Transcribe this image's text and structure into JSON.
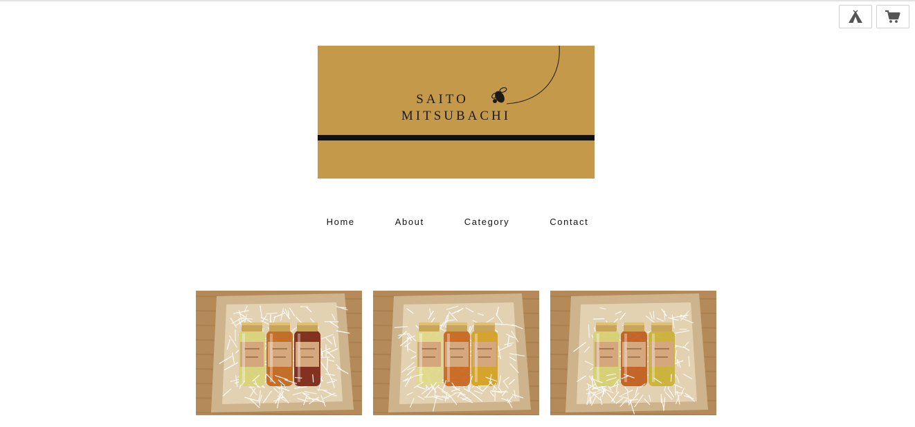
{
  "header": {
    "icons": [
      {
        "name": "tent-icon"
      },
      {
        "name": "cart-icon"
      }
    ]
  },
  "logo": {
    "line1": "SAITO",
    "line2": "MITSUBACHI",
    "colors": {
      "background": "#c49a4a",
      "stripe": "#111111",
      "text": "#1c1a16"
    }
  },
  "nav": {
    "items": [
      {
        "label": "Home"
      },
      {
        "label": "About"
      },
      {
        "label": "Category"
      },
      {
        "label": "Contact"
      }
    ]
  },
  "products": [
    {
      "name": "honey-set-1",
      "jar_colors": [
        "#d8d27a",
        "#c0661e",
        "#7a2412"
      ]
    },
    {
      "name": "honey-set-2",
      "jar_colors": [
        "#e0d98a",
        "#c8641c",
        "#d2a021"
      ]
    },
    {
      "name": "honey-set-3",
      "jar_colors": [
        "#d6cf72",
        "#c05b1a",
        "#c9b033"
      ]
    }
  ]
}
